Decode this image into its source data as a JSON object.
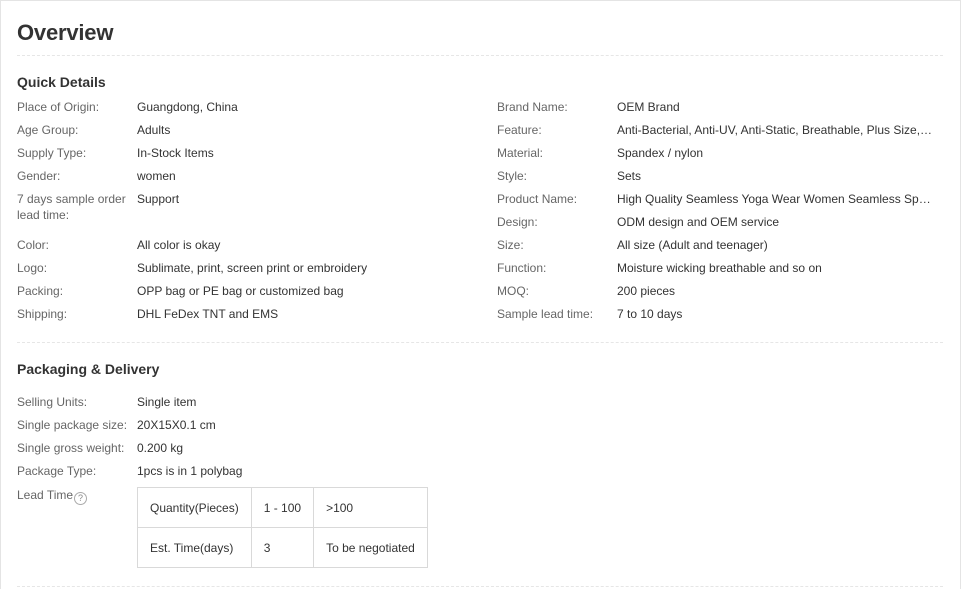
{
  "page_title": "Overview",
  "quick_details": {
    "title": "Quick Details",
    "left": [
      {
        "label": "Place of Origin:",
        "value": "Guangdong, China"
      },
      {
        "label": "Age Group:",
        "value": "Adults"
      },
      {
        "label": "Supply Type:",
        "value": "In-Stock Items"
      },
      {
        "label": "Gender:",
        "value": "women"
      },
      {
        "label": "7 days sample order lead time:",
        "value": "Support"
      },
      {
        "label": "Color:",
        "value": "All color is okay"
      },
      {
        "label": "Logo:",
        "value": "Sublimate, print, screen print or embroidery"
      },
      {
        "label": "Packing:",
        "value": "OPP bag or PE bag or customized bag"
      },
      {
        "label": "Shipping:",
        "value": "DHL FeDex TNT and EMS"
      }
    ],
    "right": [
      {
        "label": "Brand Name:",
        "value": "OEM Brand"
      },
      {
        "label": "Feature:",
        "value": "Anti-Bacterial, Anti-UV, Anti-Static, Breathable, Plus Size, QUI..."
      },
      {
        "label": "Material:",
        "value": "Spandex / nylon"
      },
      {
        "label": "Style:",
        "value": "Sets"
      },
      {
        "label": "Product Name:",
        "value": "High Quality Seamless Yoga Wear Women Seamless Sports ..."
      },
      {
        "label": "Design:",
        "value": "ODM design and OEM service"
      },
      {
        "label": "Size:",
        "value": "All size (Adult and teenager)"
      },
      {
        "label": "Function:",
        "value": "Moisture wicking breathable and so on"
      },
      {
        "label": "MOQ:",
        "value": "200 pieces"
      },
      {
        "label": "Sample lead time:",
        "value": "7 to 10 days"
      }
    ]
  },
  "packaging": {
    "title": "Packaging & Delivery",
    "items": [
      {
        "label": "Selling Units:",
        "value": "Single item"
      },
      {
        "label": "Single package size:",
        "value": "20X15X0.1 cm"
      },
      {
        "label": "Single gross weight:",
        "value": "0.200 kg"
      },
      {
        "label": "Package Type:",
        "value": "1pcs is in 1 polybag"
      }
    ],
    "lead_time_label": "Lead Time",
    "help_icon_glyph": "?",
    "lead_table": {
      "row1": [
        "Quantity(Pieces)",
        "1 - 100",
        ">100"
      ],
      "row2": [
        "Est. Time(days)",
        "3",
        "To be negotiated"
      ]
    }
  }
}
